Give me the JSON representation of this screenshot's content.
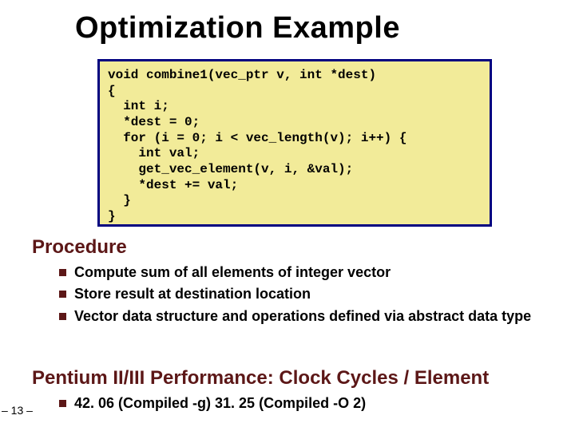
{
  "title": "Optimization Example",
  "code": "void combine1(vec_ptr v, int *dest)\n{\n  int i;\n  *dest = 0;\n  for (i = 0; i < vec_length(v); i++) {\n    int val;\n    get_vec_element(v, i, &val);\n    *dest += val;\n  }\n}",
  "sections": {
    "procedure": {
      "heading": "Procedure",
      "items": [
        "Compute sum of all elements of integer vector",
        "Store result at destination location",
        "Vector data structure and operations defined via abstract data type"
      ]
    },
    "performance": {
      "heading": "Pentium II/III Performance: Clock Cycles / Element",
      "items": [
        "42. 06 (Compiled -g) 31. 25 (Compiled -O 2)"
      ]
    }
  },
  "page_label": "– 13 –"
}
